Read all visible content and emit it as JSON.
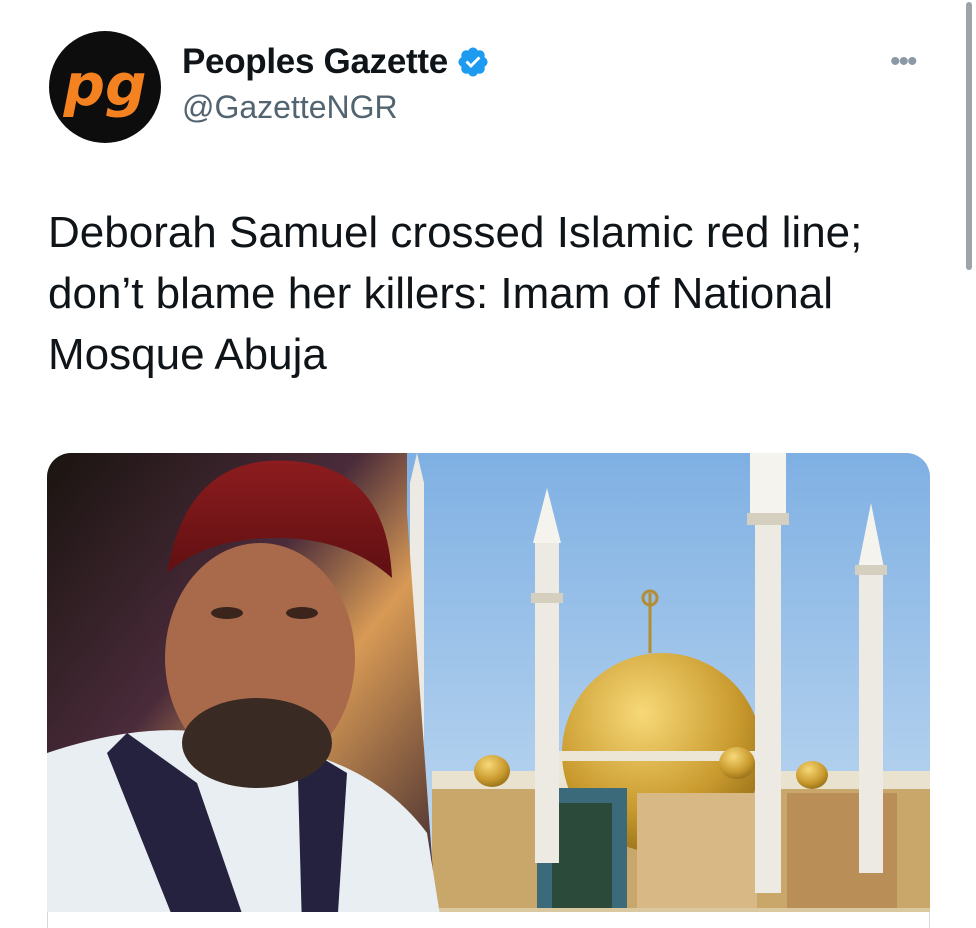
{
  "tweet": {
    "display_name": "Peoples Gazette",
    "handle": "@GazetteNGR",
    "verified": true,
    "avatar_text": "pg",
    "text": "Deborah Samuel crossed Islamic red line; don’t blame her killers: Imam of National Mosque Abuja",
    "more_icon": "ellipsis-icon"
  },
  "colors": {
    "brand_orange": "#f58220",
    "avatar_bg": "#0d0d0d",
    "verified_blue": "#1d9bf0",
    "text": "#0f1419",
    "secondary_text": "#536471"
  }
}
